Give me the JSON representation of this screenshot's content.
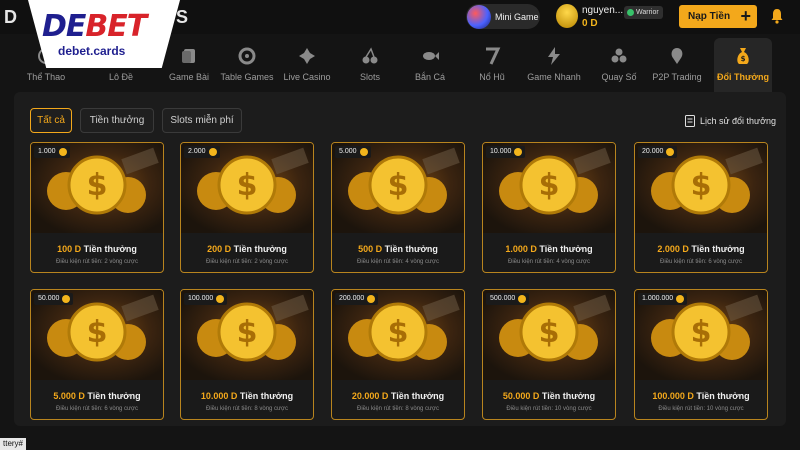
{
  "brand": {
    "logo_de": "DE",
    "logo_bet": "BET",
    "logo_sub": "debet.cards",
    "behind_left": "D",
    "behind_right": "S"
  },
  "topbar": {
    "minigame_label": "Mini Game",
    "user_name": "nguyen...",
    "user_balance": "0 D",
    "user_rank": "Warrior",
    "deposit_label": "Nạp Tiền",
    "deposit_plus": "+"
  },
  "nav": [
    {
      "label": "Thể Thao",
      "icon": "sports-icon"
    },
    {
      "label": "Lô Đề",
      "icon": "lottery-icon"
    },
    {
      "label": "Game Bài",
      "icon": "cards-icon"
    },
    {
      "label": "Table Games",
      "icon": "chip-icon"
    },
    {
      "label": "Live Casino",
      "icon": "casino-icon"
    },
    {
      "label": "Slots",
      "icon": "cherry-icon"
    },
    {
      "label": "Bắn Cá",
      "icon": "fish-icon"
    },
    {
      "label": "Nổ Hũ",
      "icon": "seven-icon"
    },
    {
      "label": "Game Nhanh",
      "icon": "lightning-icon"
    },
    {
      "label": "Quay Số",
      "icon": "balls-icon"
    },
    {
      "label": "P2P Trading",
      "icon": "p2p-icon"
    },
    {
      "label": "Đổi Thưởng",
      "icon": "money-bag-icon",
      "active": true
    }
  ],
  "filters": [
    {
      "label": "Tất cả",
      "active": true
    },
    {
      "label": "Tiền thưởng"
    },
    {
      "label": "Slots miễn phí"
    }
  ],
  "history_label": "Lịch sử đổi thưởng",
  "rewards": [
    {
      "price": "1.000",
      "amount": "100 D",
      "suffix": "Tiền thưởng",
      "cond": "Điều kiện rút tiền: 2 vòng cược"
    },
    {
      "price": "2.000",
      "amount": "200 D",
      "suffix": "Tiền thưởng",
      "cond": "Điều kiện rút tiền: 2 vòng cược"
    },
    {
      "price": "5.000",
      "amount": "500 D",
      "suffix": "Tiền thưởng",
      "cond": "Điều kiện rút tiền: 4 vòng cược"
    },
    {
      "price": "10.000",
      "amount": "1.000 D",
      "suffix": "Tiền thưởng",
      "cond": "Điều kiện rút tiền: 4 vòng cược"
    },
    {
      "price": "20.000",
      "amount": "2.000 D",
      "suffix": "Tiền thưởng",
      "cond": "Điều kiện rút tiền: 6 vòng cược"
    },
    {
      "price": "50.000",
      "amount": "5.000 D",
      "suffix": "Tiền thưởng",
      "cond": "Điều kiện rút tiền: 6 vòng cược"
    },
    {
      "price": "100.000",
      "amount": "10.000 D",
      "suffix": "Tiền thưởng",
      "cond": "Điều kiện rút tiền: 8 vòng cược"
    },
    {
      "price": "200.000",
      "amount": "20.000 D",
      "suffix": "Tiền thưởng",
      "cond": "Điều kiện rút tiền: 8 vòng cược"
    },
    {
      "price": "500.000",
      "amount": "50.000 D",
      "suffix": "Tiền thưởng",
      "cond": "Điều kiện rút tiền: 10 vòng cược"
    },
    {
      "price": "1.000.000",
      "amount": "100.000 D",
      "suffix": "Tiền thưởng",
      "cond": "Điều kiện rút tiền: 10 vòng cược"
    }
  ],
  "footer_tag": "ttery#",
  "colors": {
    "accent": "#f3a81b",
    "background": "#141414",
    "panel": "#1c1c1c"
  }
}
